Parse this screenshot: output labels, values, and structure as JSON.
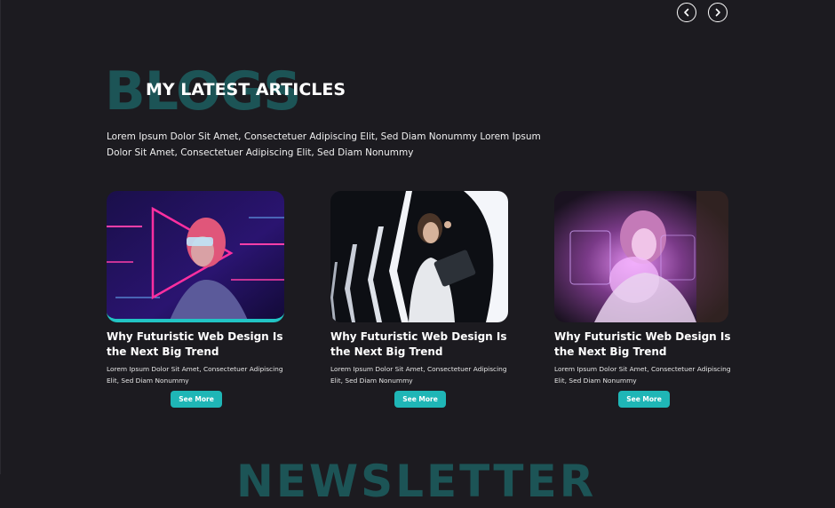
{
  "slider": {
    "prev_icon": "chevron-left-icon",
    "next_icon": "chevron-right-icon"
  },
  "section": {
    "bg_title": "BLOGS",
    "title": "MY LATEST ARTICLES",
    "description": "Lorem Ipsum Dolor Sit Amet, Consectetuer Adipiscing Elit, Sed Diam Nonummy Lorem Ipsum Dolor Sit Amet, Consectetuer Adipiscing Elit, Sed Diam Nonummy"
  },
  "cards": [
    {
      "title": "Why Futuristic Web Design Is the Next Big Trend",
      "excerpt": "Lorem Ipsum Dolor Sit Amet, Consectetuer Adipiscing Elit, Sed Diam Nonummy",
      "button": "See More"
    },
    {
      "title": "Why Futuristic Web Design Is the Next Big Trend",
      "excerpt": "Lorem Ipsum Dolor Sit Amet, Consectetuer Adipiscing Elit, Sed Diam Nonummy",
      "button": "See More"
    },
    {
      "title": "Why Futuristic Web Design Is the Next Big Trend",
      "excerpt": "Lorem Ipsum Dolor Sit Amet, Consectetuer Adipiscing Elit, Sed Diam Nonummy",
      "button": "See More"
    }
  ],
  "newsletter": {
    "bg_title": "NEWSLETTER"
  },
  "colors": {
    "background": "#1c1b20",
    "accent": "#1fb6b6",
    "bg_title": "#1c5456"
  }
}
